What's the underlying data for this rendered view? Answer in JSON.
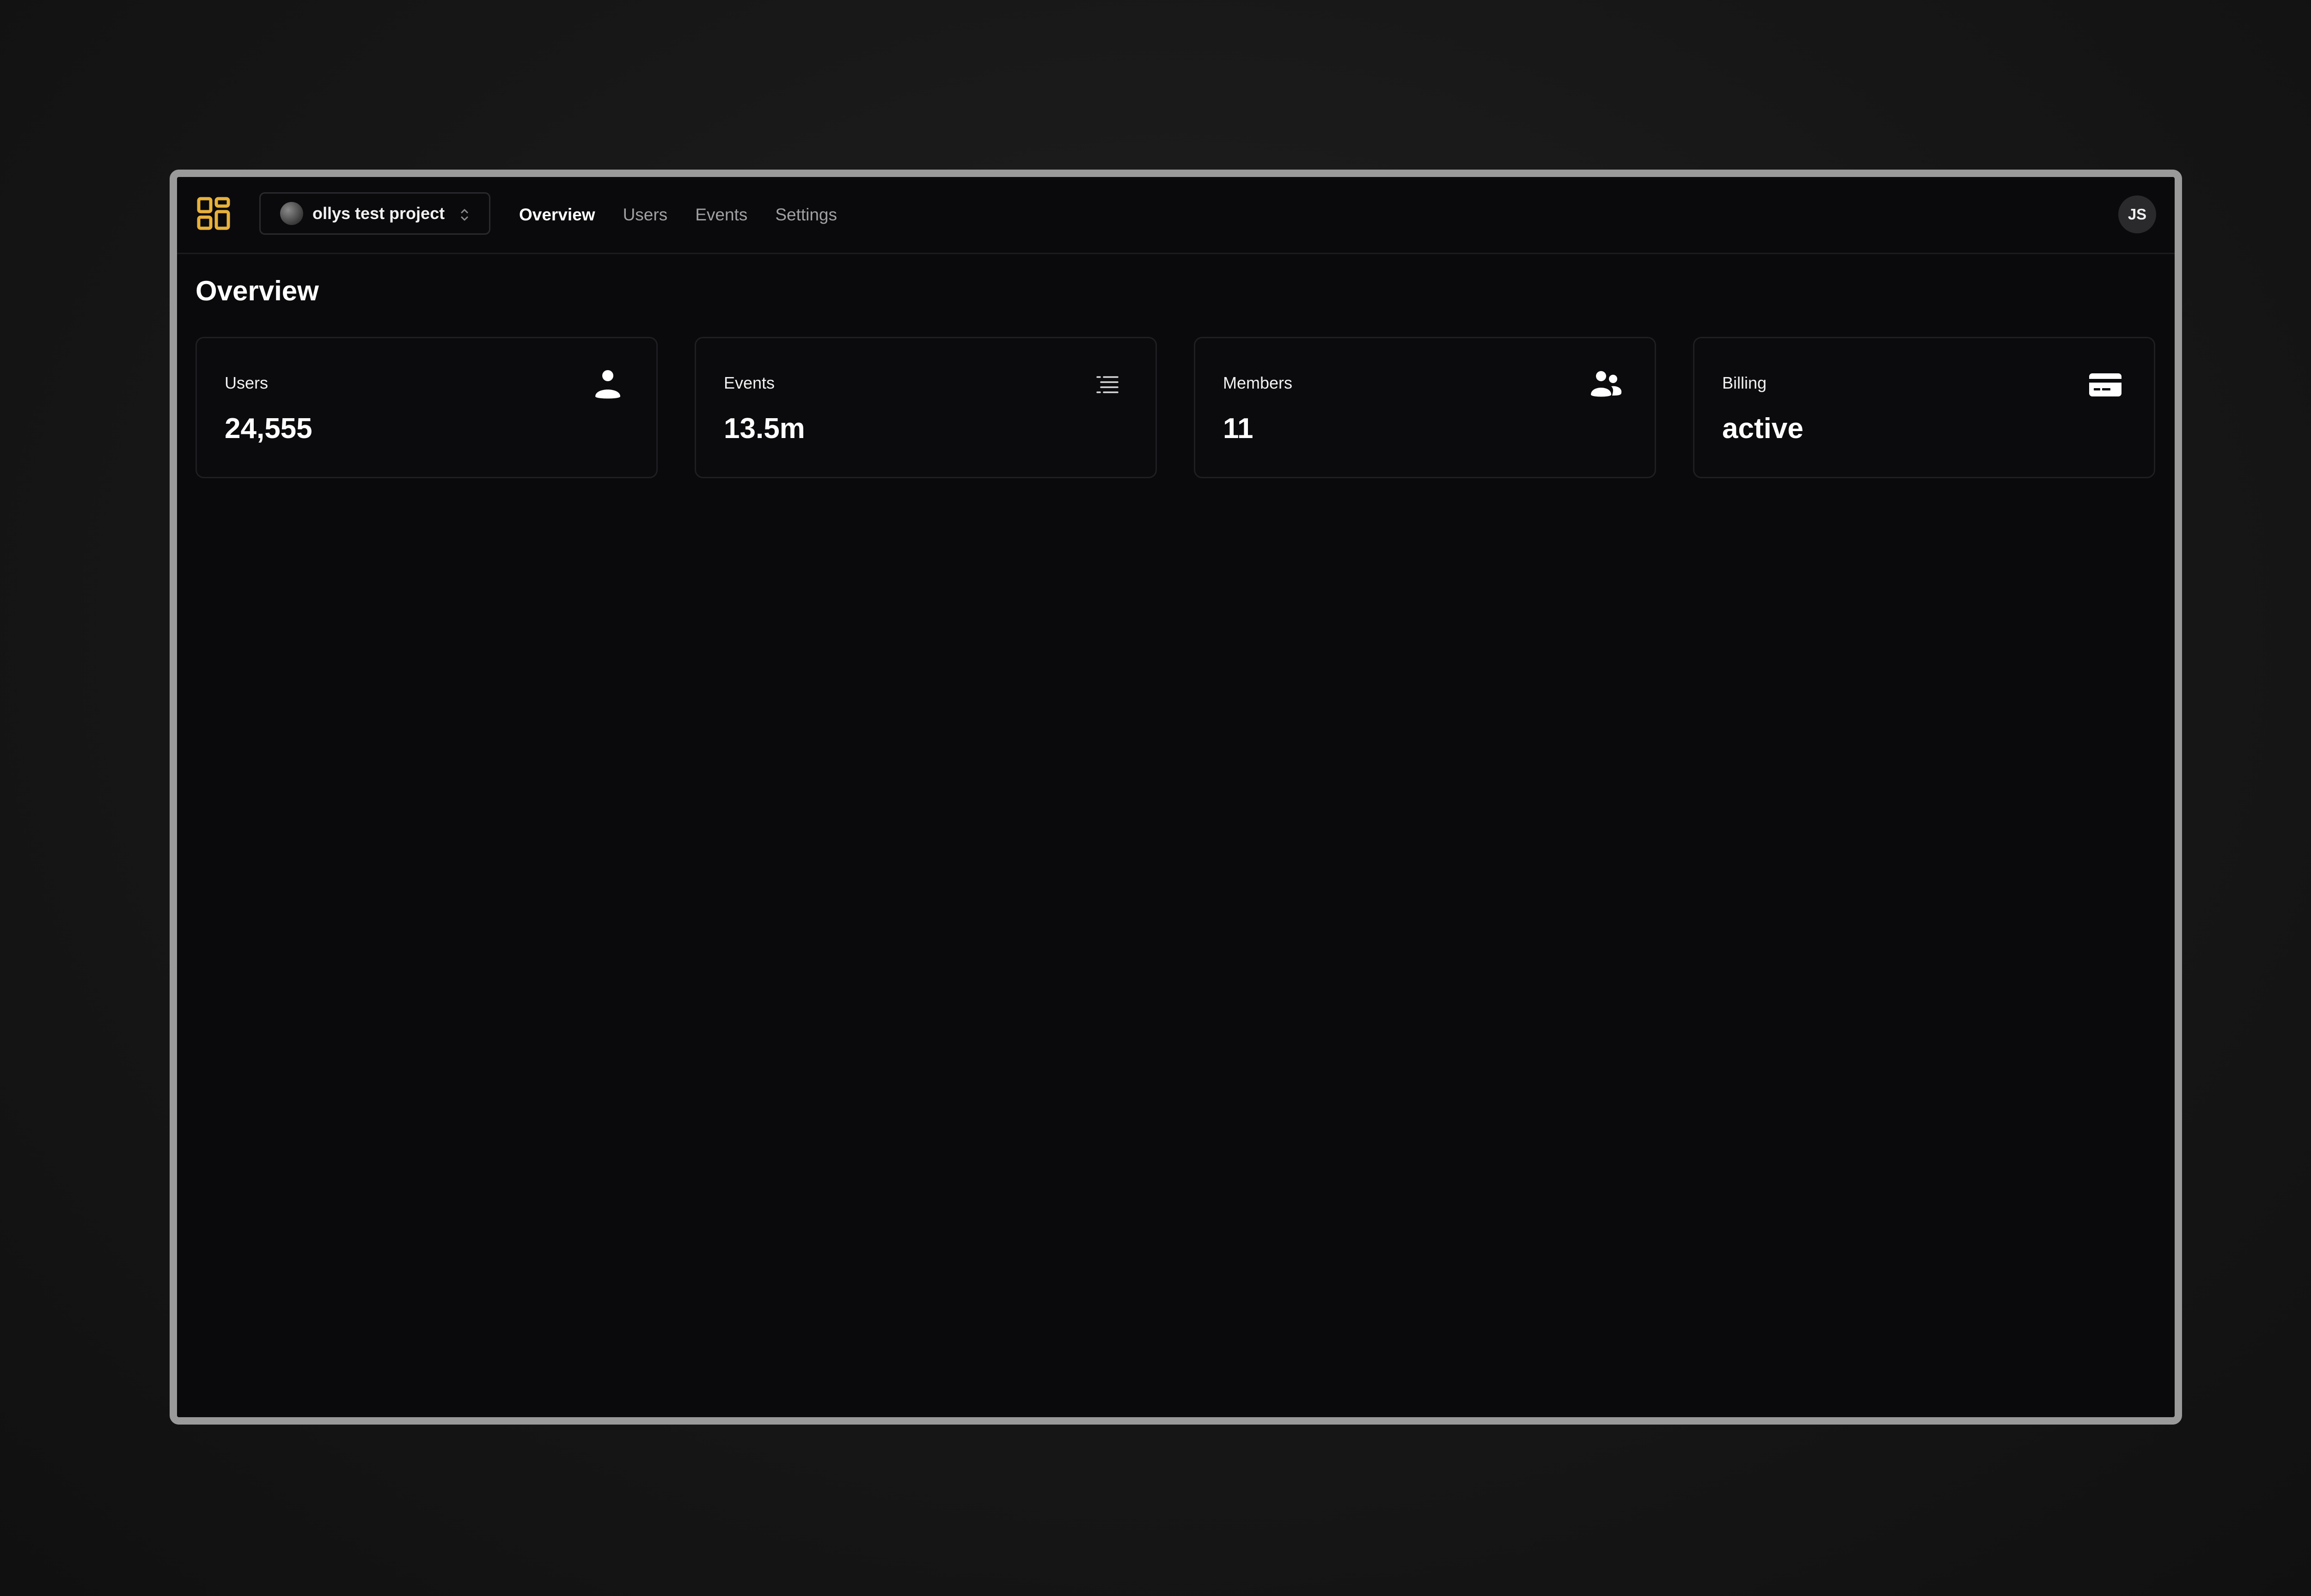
{
  "header": {
    "project": {
      "name": "ollys test project"
    },
    "nav": [
      {
        "label": "Overview",
        "active": true
      },
      {
        "label": "Users",
        "active": false
      },
      {
        "label": "Events",
        "active": false
      },
      {
        "label": "Settings",
        "active": false
      }
    ],
    "user": {
      "initials": "JS"
    }
  },
  "page": {
    "title": "Overview"
  },
  "stats": [
    {
      "label": "Users",
      "value": "24,555",
      "icon": "user-icon"
    },
    {
      "label": "Events",
      "value": "13.5m",
      "icon": "list-icon"
    },
    {
      "label": "Members",
      "value": "11",
      "icon": "users-icon"
    },
    {
      "label": "Billing",
      "value": "active",
      "icon": "credit-card-icon"
    }
  ],
  "colors": {
    "accent": "#e8b13a",
    "background": "#0a0a0c",
    "card_border": "#1f1f23",
    "frame": "#9a9a9a",
    "muted_text": "#a0a0a4"
  }
}
